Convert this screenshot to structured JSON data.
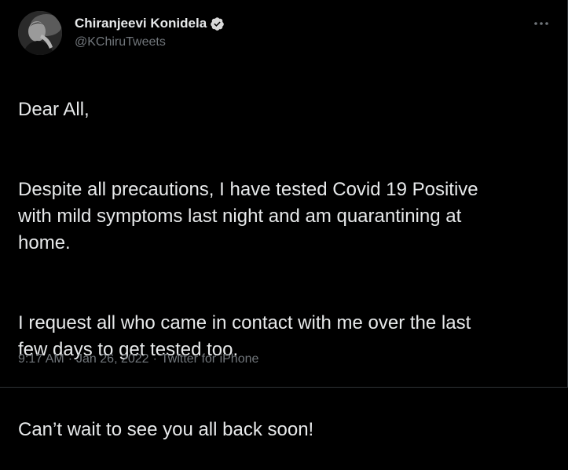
{
  "colors": {
    "background": "#000000",
    "text_primary": "#e7e9ea",
    "text_secondary": "#71767b",
    "verified_badge": "#d9d9d9",
    "divider": "#2f3336"
  },
  "author": {
    "display_name": "Chiranjeevi Konidela",
    "handle": "@KChiruTweets",
    "verified": true,
    "avatar_icon": "profile-photo"
  },
  "menu": {
    "icon": "more-horizontal-icon"
  },
  "tweet": {
    "paragraphs": [
      "Dear All,",
      "Despite all precautions, I have tested Covid 19 Positive\nwith mild symptoms last night and am quarantining at\nhome.",
      "I request all who came in contact with me over the last\nfew days to get tested too.",
      "Can’t wait to see you all back soon!"
    ],
    "time": "9:17 AM",
    "date": "Jan 26, 2022",
    "source": "Twitter for iPhone",
    "separator": "·"
  }
}
